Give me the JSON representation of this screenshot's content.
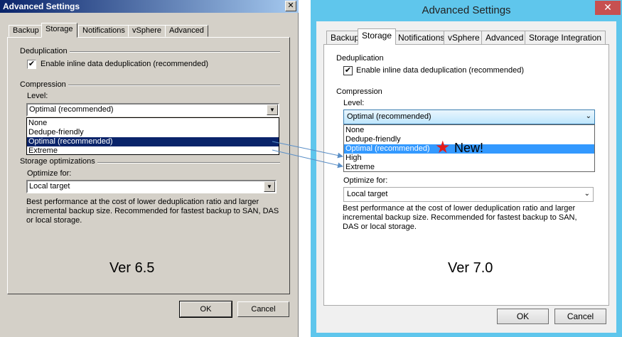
{
  "left_dialog": {
    "title": "Advanced Settings",
    "close_glyph": "✕",
    "tabs": [
      "Backup",
      "Storage",
      "Notifications",
      "vSphere",
      "Advanced"
    ],
    "active_tab": "Storage",
    "dedup_group": "Deduplication",
    "dedup_checkbox_label": "Enable inline data deduplication (recommended)",
    "dedup_checked": true,
    "compression_group": "Compression",
    "level_label": "Level:",
    "level_value": "Optimal (recommended)",
    "level_options": [
      "None",
      "Dedupe-friendly",
      "Optimal (recommended)",
      "Extreme"
    ],
    "storage_group": "Storage optimizations",
    "optimize_label": "Optimize for:",
    "optimize_value": "Local target",
    "description": "Best performance at the cost of lower deduplication ratio and larger incremental backup size. Recommended for fastest backup to SAN, DAS or local storage.",
    "version_label": "Ver 6.5",
    "ok_label": "OK",
    "cancel_label": "Cancel"
  },
  "right_dialog": {
    "title": "Advanced Settings",
    "close_glyph": "✕",
    "tabs": [
      "Backup",
      "Storage",
      "Notifications",
      "vSphere",
      "Advanced",
      "Storage Integration"
    ],
    "active_tab": "Storage",
    "dedup_group": "Deduplication",
    "dedup_checkbox_label": "Enable inline data deduplication (recommended)",
    "dedup_checked": true,
    "compression_group": "Compression",
    "level_label": "Level:",
    "level_value": "Optimal (recommended)",
    "level_options": [
      "None",
      "Dedupe-friendly",
      "Optimal (recommended)",
      "High",
      "Extreme"
    ],
    "new_annotation": "New!",
    "optimize_label": "Optimize for:",
    "optimize_value": "Local target",
    "description": "Best performance at the cost of lower deduplication ratio and larger incremental backup size. Recommended for fastest backup to SAN, DAS or local storage.",
    "version_label": "Ver 7.0",
    "ok_label": "OK",
    "cancel_label": "Cancel"
  },
  "colors": {
    "classic_face": "#d4d0c8",
    "classic_title": "#0a246a",
    "modern_frame": "#5fc6ec",
    "modern_selection": "#3399ff",
    "star": "#e31b1b",
    "arrow": "#5a8fc7"
  }
}
